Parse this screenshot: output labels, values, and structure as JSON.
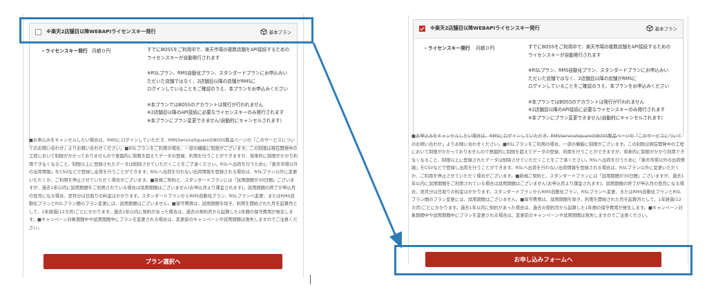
{
  "plan": {
    "title": "※楽天2店舗目以降WEBAPIライセンスキー発行",
    "tag": "基本プラン",
    "item_name": "・ライセンスキー発行",
    "item_price": "月額０円",
    "desc": [
      "すでにBOSSをご利用中で、楽天市場の複数店舗をAPI接続するための\nライセンスキーが自動発行されます",
      "※RSLプラン、RMS自動化プラン、スタンダードプランにお申込みい\nただいた店舗ではなく、2店舗目以降の店舗がRMSに\nログインしていることをご確認のうえ、本プランをお申込みください",
      "※本プランではBOSSのアカウントは発行が行われません\n※2店舗目以降のAPI接続に必要なライセンスキーのみ発行されます\n※本プランにプラン変更できません(自動的にキャンセルされます)"
    ]
  },
  "notice": "■お申込みをキャンセルしたい場合は、RMSにログインしていただき、RMSServiceSquareのBOSS製品ページの「このサービスについてのお問い合わせ」よりお問い合わせください。■RSLプランをご利用の場合、一部の機能に制限がございます。この制限は現在開発中の工程において制限がかかっておりませんので意図的に制限を超えてデータの登録、利用を行うことができますが、将来的に制限がかかり利用できなくなること、制限以上に登録されたデータは削除させていただくことをご了承ください。RSLへ出荷を行うために「楽天市場以外の出荷情報」をCSVなどで登録し出荷を行うことができます。RSLへ出荷を行わない出荷情報を登録される場合は、RSLプラン以外に変更いただくか、ご利用を停止させていただく場合がございます。■新規ご契約と、スタンダードプランには「試用期間が30日間」ございますが、過去1年以内に試用期間をご利用されている場合は試用期間はございません(お申込月より課金されます)。試用期間の終了が申込月の翌月になる場合、翌月分は日割りの料金はかかります。スタンダードプランからRMS自動化プラン、RSLプランへ変更、またはRMS自動化プランとRSLプラン間のプラン変更には、試用期間はございません。■保守費用は、試用期間を除き、利用を開始された月を起算月として、1年経過(12カ月)ごとにかかります。過去1年以内に契約があった場合は、過去の契約月から起算した1年間の保守費用が発生します。■キャンペーン対象期間中や試用期間中にプランを変更される場合は、変更前のキャンペーンや試用期間は喪失しますのでご注意ください。",
  "left_button": "プラン選択へ",
  "right_button": "お申し込みフォームへ",
  "colors": {
    "accent": "#b32a1f",
    "highlight": "#2f7bb6"
  }
}
